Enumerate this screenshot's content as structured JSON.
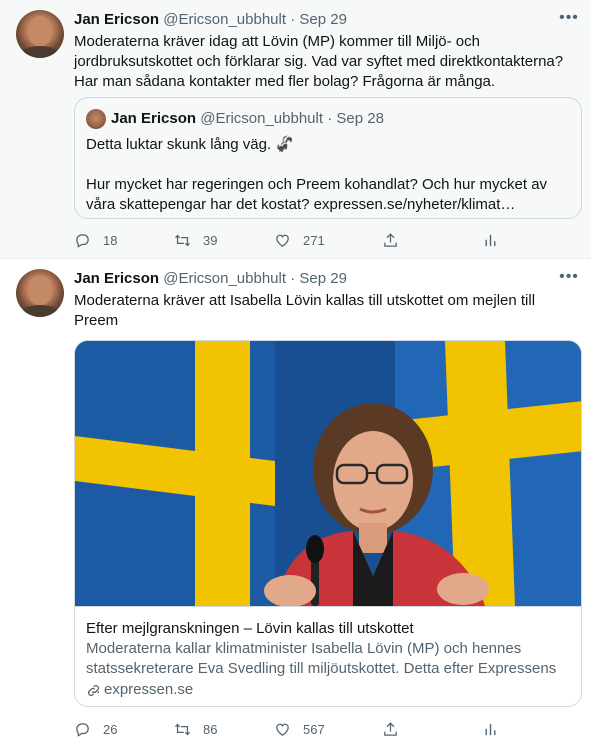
{
  "tweets": [
    {
      "author": {
        "name": "Jan Ericson",
        "handle": "@Ericson_ubbhult"
      },
      "date": "Sep 29",
      "separator": "·",
      "text": "Moderaterna kräver idag att Lövin (MP) kommer till Miljö- och jordbruksutskottet och förklarar sig. Vad var syftet med direktkontakterna? Har man sådana kontakter med fler bolag? Frågorna är många.",
      "quote": {
        "author": {
          "name": "Jan Ericson",
          "handle": "@Ericson_ubbhult"
        },
        "date": "Sep 28",
        "separator": "·",
        "line1": "Detta luktar skunk lång väg. 🦨",
        "line2": "Hur mycket har regeringen och Preem kohandlat? Och hur mycket av våra skattepengar har  det kostat?",
        "link": "expressen.se/nyheter/klimat…"
      },
      "actions": {
        "replies": "18",
        "retweets": "39",
        "likes": "271"
      }
    },
    {
      "author": {
        "name": "Jan Ericson",
        "handle": "@Ericson_ubbhult"
      },
      "date": "Sep 29",
      "separator": "·",
      "text": "Moderaterna kräver att Isabella Lövin kallas till utskottet om mejlen till Preem",
      "card": {
        "title": "Efter mejlgranskningen – Lövin kallas till utskottet",
        "description": "Moderaterna kallar klimatminister Isabella Lövin (MP) och hennes statssekreterare Eva Svedling till miljöutskottet. Detta efter Expressens …",
        "domain": "expressen.se"
      },
      "actions": {
        "replies": "26",
        "retweets": "86",
        "likes": "567"
      }
    }
  ],
  "colors": {
    "text": "#0f1419",
    "secondary": "#536471",
    "border": "#cfd9de",
    "flag_blue": "#1e63b0",
    "flag_yellow": "#f2c300",
    "jacket_red": "#c8343a"
  },
  "icons": [
    "more-icon",
    "reply-icon",
    "retweet-icon",
    "like-icon",
    "share-icon",
    "analytics-icon",
    "link-icon"
  ]
}
